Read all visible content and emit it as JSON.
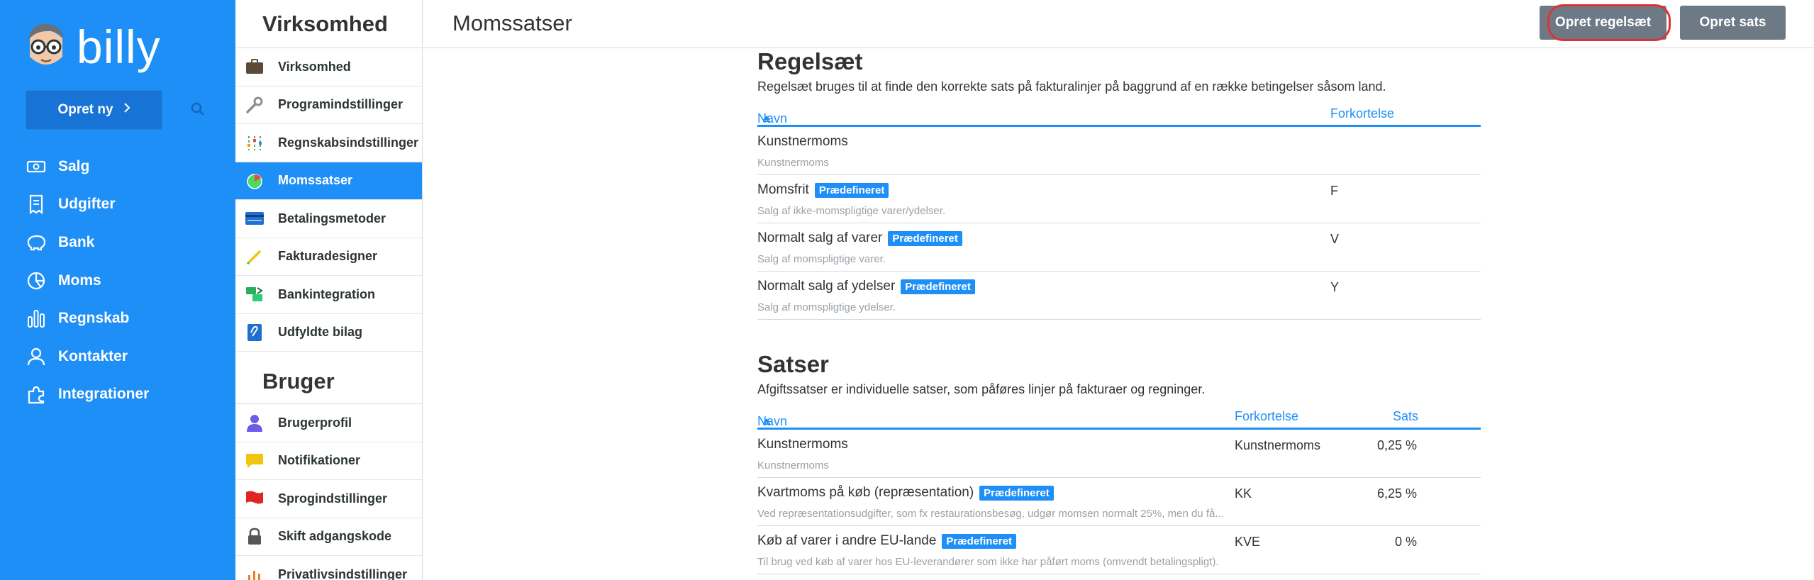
{
  "app": {
    "logo_text": "billy",
    "create_label": "Opret ny",
    "nav": [
      {
        "label": "Salg",
        "icon": "money-icon"
      },
      {
        "label": "Udgifter",
        "icon": "receipt-icon"
      },
      {
        "label": "Bank",
        "icon": "piggy-bank-icon"
      },
      {
        "label": "Moms",
        "icon": "pie-chart-icon"
      },
      {
        "label": "Regnskab",
        "icon": "bar-chart-icon"
      },
      {
        "label": "Kontakter",
        "icon": "person-icon"
      },
      {
        "label": "Integrationer",
        "icon": "puzzle-icon"
      }
    ]
  },
  "settings": {
    "company_heading": "Virksomhed",
    "company_items": [
      {
        "label": "Virksomhed",
        "icon": "briefcase-icon"
      },
      {
        "label": "Programindstillinger",
        "icon": "wrench-icon"
      },
      {
        "label": "Regnskabsindstillinger",
        "icon": "sliders-icon"
      },
      {
        "label": "Momssatser",
        "icon": "pie-icon",
        "active": true
      },
      {
        "label": "Betalingsmetoder",
        "icon": "card-icon"
      },
      {
        "label": "Fakturadesigner",
        "icon": "pencil-icon"
      },
      {
        "label": "Bankintegration",
        "icon": "money-transfer-icon"
      },
      {
        "label": "Udfyldte bilag",
        "icon": "paperclip-icon"
      }
    ],
    "user_heading": "Bruger",
    "user_items": [
      {
        "label": "Brugerprofil",
        "icon": "user-icon"
      },
      {
        "label": "Notifikationer",
        "icon": "speech-bubble-icon"
      },
      {
        "label": "Sprogindstillinger",
        "icon": "flag-icon"
      },
      {
        "label": "Skift adgangskode",
        "icon": "lock-icon"
      },
      {
        "label": "Privatlivsindstillinger",
        "icon": "chart-icon"
      }
    ]
  },
  "header": {
    "title": "Momssatser",
    "btn_create_ruleset": "Opret regelsæt",
    "btn_create_rate": "Opret sats"
  },
  "rulesets": {
    "title": "Regelsæt",
    "description": "Regelsæt bruges til at finde den korrekte sats på fakturalinjer på baggrund af en række betingelser såsom land.",
    "col_name": "Navn",
    "col_abbr": "Forkortelse",
    "rows": [
      {
        "name": "Kunstnermoms",
        "badge": "",
        "desc": "Kunstnermoms",
        "abbr": ""
      },
      {
        "name": "Momsfrit",
        "badge": "Prædefineret",
        "desc": "Salg af ikke-momspligtige varer/ydelser.",
        "abbr": "F"
      },
      {
        "name": "Normalt salg af varer",
        "badge": "Prædefineret",
        "desc": "Salg af momspligtige varer.",
        "abbr": "V"
      },
      {
        "name": "Normalt salg af ydelser",
        "badge": "Prædefineret",
        "desc": "Salg af momspligtige ydelser.",
        "abbr": "Y"
      }
    ]
  },
  "rates": {
    "title": "Satser",
    "description": "Afgiftssatser er individuelle satser, som påføres linjer på fakturaer og regninger.",
    "col_name": "Navn",
    "col_abbr": "Forkortelse",
    "col_rate": "Sats",
    "rows": [
      {
        "name": "Kunstnermoms",
        "badge": "",
        "desc": "Kunstnermoms",
        "abbr": "Kunstnermoms",
        "rate": "0,25 %"
      },
      {
        "name": "Kvartmoms på køb (repræsentation)",
        "badge": "Prædefineret",
        "desc": "Ved repræsentationsudgifter, som fx restaurationsbesøg, udgør momsen normalt 25%, men du få...",
        "abbr": "KK",
        "rate": "6,25 %"
      },
      {
        "name": "Køb af varer i andre EU-lande",
        "badge": "Prædefineret",
        "desc": "Til brug ved køb af varer hos EU-leverandører som ikke har påført moms (omvendt betalingspligt).",
        "abbr": "KVE",
        "rate": "0 %"
      }
    ]
  },
  "colors": {
    "primary": "#1e8ff7",
    "button_grey": "#6d7a86",
    "highlight": "#e03131"
  }
}
